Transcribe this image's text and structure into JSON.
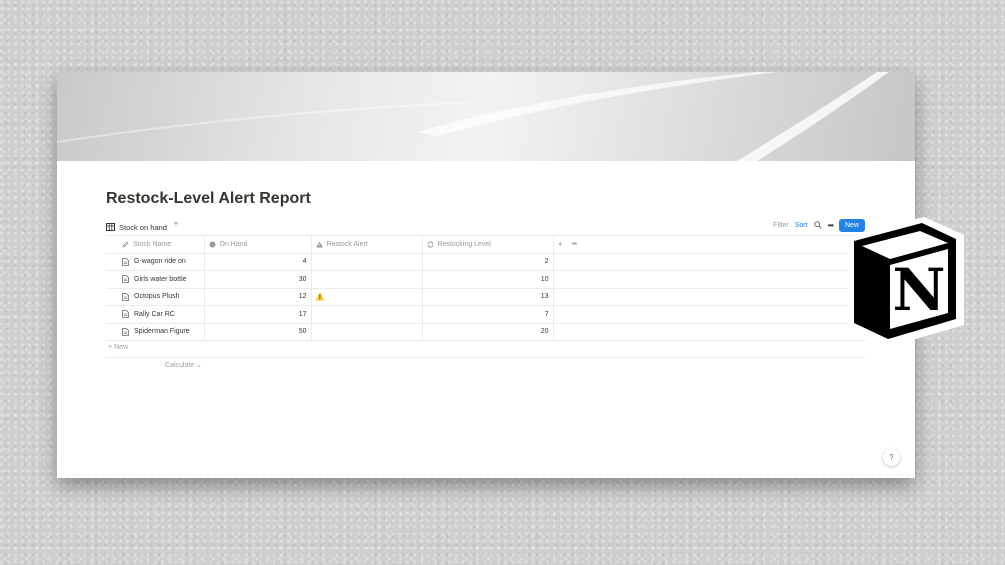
{
  "page": {
    "title": "Restock-Level Alert Report"
  },
  "view": {
    "tab_label": "Stock on hand",
    "add_view": "+"
  },
  "toolbar": {
    "filter": "Filter",
    "sort": "Sort",
    "more": "•••",
    "new": "New"
  },
  "table": {
    "columns": [
      {
        "label": "Stock Name",
        "icon": "pencil-icon"
      },
      {
        "label": "On Hand",
        "icon": "number-icon"
      },
      {
        "label": "Restock Alert",
        "icon": "warning-icon"
      },
      {
        "label": "Restocking Level",
        "icon": "refresh-icon"
      }
    ],
    "add_column": "+",
    "column_more": "•••",
    "rows": [
      {
        "name": "G-wagon ride on",
        "on_hand": "4",
        "alert": "",
        "level": "2"
      },
      {
        "name": "Girls water bottle",
        "on_hand": "30",
        "alert": "",
        "level": "10"
      },
      {
        "name": "Octopus Plush",
        "on_hand": "12",
        "alert": "⚠️",
        "level": "13"
      },
      {
        "name": "Rally Car RC",
        "on_hand": "17",
        "alert": "",
        "level": "7"
      },
      {
        "name": "Spiderman Figure",
        "on_hand": "50",
        "alert": "",
        "level": "20"
      }
    ],
    "new_row": "+ New",
    "calculate": "Calculate ⌄"
  },
  "help": "?",
  "logo": {
    "letter": "N"
  },
  "colors": {
    "accent": "#2383e2",
    "text": "#37352f",
    "muted": "#9b9a97",
    "border": "#ebebea"
  }
}
